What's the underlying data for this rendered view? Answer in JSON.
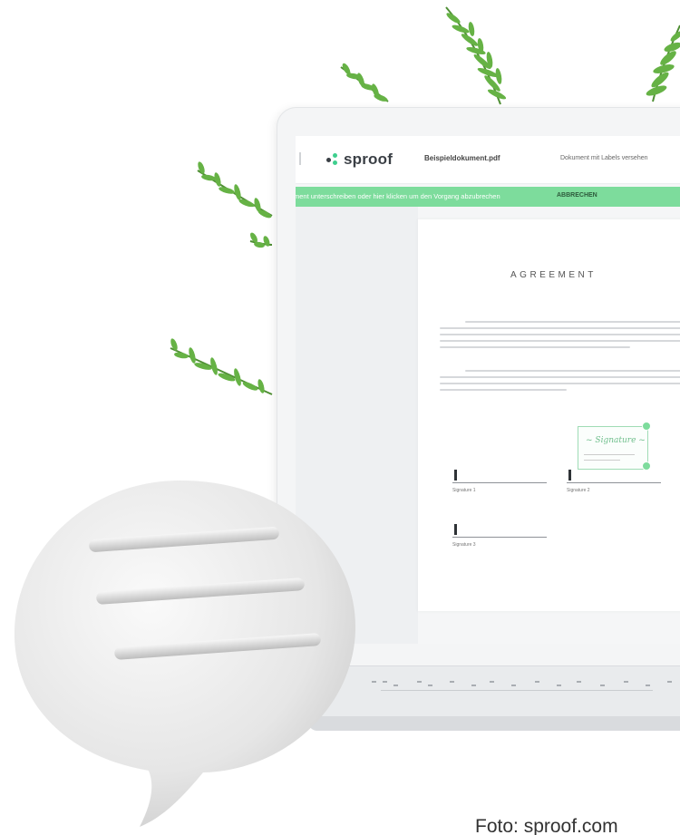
{
  "app": {
    "logo_text": "sproof",
    "document_name": "Beispieldokument.pdf",
    "document_labels": "Dokument mit Labels versehen"
  },
  "banner": {
    "message": "ment unterschreiben oder hier klicken um den Vorgang abzubrechen",
    "cancel_label": "ABBRECHEN"
  },
  "document": {
    "title": "AGREEMENT",
    "signature_labels": [
      "Signature 1",
      "Signature 2",
      "Signature 3"
    ]
  },
  "caption": "Foto: sproof.com",
  "colors": {
    "accent_green": "#7ddc9c",
    "fern_green": "#5aa33a",
    "logo_dots": [
      "#3ecf8e",
      "#3a3f45",
      "#3ecf8e"
    ]
  },
  "icons": [
    "menu-handle-icon",
    "sproof-logo-icon",
    "speech-bubble-icon",
    "fern-icon"
  ]
}
